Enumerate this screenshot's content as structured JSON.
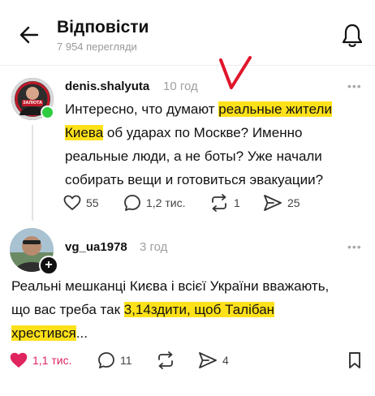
{
  "header": {
    "title": "Відповісти",
    "views": "7 954 перегляди",
    "back_icon": "arrow-left-icon",
    "bell_icon": "bell-icon"
  },
  "annotation": {
    "mark": "V",
    "color": "#e0162b"
  },
  "colors": {
    "highlight": "#ffe11a",
    "online": "#2ecc40",
    "liked": "#e0245e"
  },
  "post1": {
    "username": "denis.shalyuta",
    "time": "10 год",
    "line1_a": "Интересно, что думают ",
    "line1_hl": "реальные жители",
    "line2_hl": "Киева",
    "line2_b": " об ударах по Москве? Именно",
    "line3": "реальные люди, а не боты? Уже начали",
    "line4": "собирать вещи и готовиться эвакуации?",
    "likes": "55",
    "comments": "1,2 тис.",
    "reposts": "1",
    "shares": "25",
    "avatar_badge": "ЗАЛЮТА"
  },
  "post2": {
    "username": "vg_ua1978",
    "time": "3 год",
    "line1": "Реальні мешканці Києва і всієї України вважають,",
    "line2_a": "що вас треба так ",
    "line2_hl": "3,14здити, щоб Талібан",
    "line3_hl": "хрестився",
    "line3_b": "...",
    "likes": "1,1 тис.",
    "comments": "11",
    "reposts": "",
    "shares": "4"
  }
}
